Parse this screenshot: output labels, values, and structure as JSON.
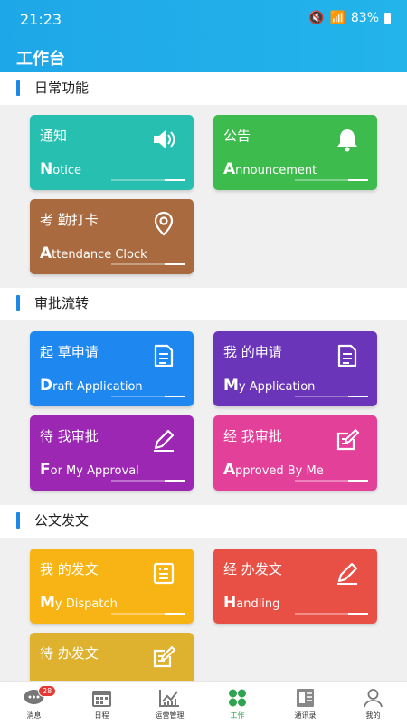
{
  "status": {
    "time": "21:23",
    "battery": "83%"
  },
  "app": {
    "title": "工作台"
  },
  "sections": [
    {
      "title": "日常功能"
    },
    {
      "title": "审批流转"
    },
    {
      "title": "公文发文"
    }
  ],
  "cards": {
    "notice": {
      "cn": "通知",
      "en_first": "N",
      "en_rest": "otice",
      "icon": "speaker-icon",
      "color": "#26bfb0"
    },
    "announcement": {
      "cn": "公告",
      "en_first": "A",
      "en_rest": "nnouncement",
      "icon": "bell-icon",
      "color": "#3dbb4c"
    },
    "attendance": {
      "cn": "考 勤打卡",
      "en_first": "A",
      "en_rest": "ttendance Clock",
      "icon": "location-pin-icon",
      "color": "#a86a3e"
    },
    "draft": {
      "cn": "起 草申请",
      "en_first": "D",
      "en_rest": "raft Application",
      "icon": "document-icon",
      "color": "#1e88f0"
    },
    "my_application": {
      "cn": "我 的申请",
      "en_first": "M",
      "en_rest": "y Application",
      "icon": "document-icon",
      "color": "#6a35b8"
    },
    "for_my_approval": {
      "cn": "待 我审批",
      "en_first": "F",
      "en_rest": "or My Approval",
      "icon": "pencil-icon",
      "color": "#9b27b3"
    },
    "approved_by_me": {
      "cn": "经 我审批",
      "en_first": "A",
      "en_rest": "pproved By Me",
      "icon": "edit-icon",
      "color": "#e3409a"
    },
    "my_dispatch": {
      "cn": "我 的发文",
      "en_first": "M",
      "en_rest": "y Dispatch",
      "icon": "document-list-icon",
      "color": "#f7b414"
    },
    "handling": {
      "cn": "经 办发文",
      "en_first": "H",
      "en_rest": "andling",
      "icon": "pencil-icon",
      "color": "#e85046"
    },
    "pending": {
      "cn": "待 办发文",
      "en_first": "",
      "en_rest": "",
      "icon": "edit-icon",
      "color": "#deb12f"
    }
  },
  "tabs": [
    {
      "label": "消息",
      "icon": "message-icon",
      "badge": "28"
    },
    {
      "label": "日程",
      "icon": "calendar-icon"
    },
    {
      "label": "运营管理",
      "icon": "chart-icon"
    },
    {
      "label": "工作",
      "icon": "work-grid-icon",
      "active": true
    },
    {
      "label": "通讯录",
      "icon": "contacts-icon"
    },
    {
      "label": "我的",
      "icon": "profile-icon"
    }
  ],
  "colors": {
    "header": "#1ea7e8",
    "active_tab": "#2ea44f"
  }
}
